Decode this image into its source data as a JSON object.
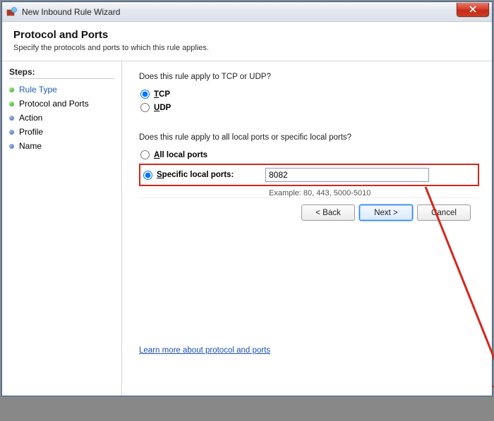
{
  "window": {
    "title": "New Inbound Rule Wizard"
  },
  "header": {
    "title": "Protocol and Ports",
    "subtitle": "Specify the protocols and ports to which this rule applies."
  },
  "steps": {
    "heading": "Steps:",
    "items": [
      {
        "label": "Rule Type",
        "state": "done"
      },
      {
        "label": "Protocol and Ports",
        "state": "current"
      },
      {
        "label": "Action",
        "state": "pending"
      },
      {
        "label": "Profile",
        "state": "pending"
      },
      {
        "label": "Name",
        "state": "pending"
      }
    ]
  },
  "main": {
    "q1": "Does this rule apply to TCP or UDP?",
    "proto": {
      "tcp": {
        "label": "TCP",
        "mnemonic": "T",
        "selected": true
      },
      "udp": {
        "label": "UDP",
        "mnemonic": "U",
        "selected": false
      }
    },
    "q2": "Does this rule apply to all local ports or specific local ports?",
    "ports": {
      "all": {
        "label": "All local ports",
        "mnemonic": "A",
        "selected": false
      },
      "specific": {
        "label": "Specific local ports:",
        "mnemonic": "S",
        "selected": true
      }
    },
    "port_value": "8082",
    "example": "Example: 80, 443, 5000-5010",
    "learn_link": "Learn more about protocol and ports"
  },
  "footer": {
    "back": "< Back",
    "next": "Next >",
    "cancel": "Cancel"
  },
  "annotation": {
    "highlight_color": "#d3261d",
    "arrow_color": "#d3261d"
  }
}
